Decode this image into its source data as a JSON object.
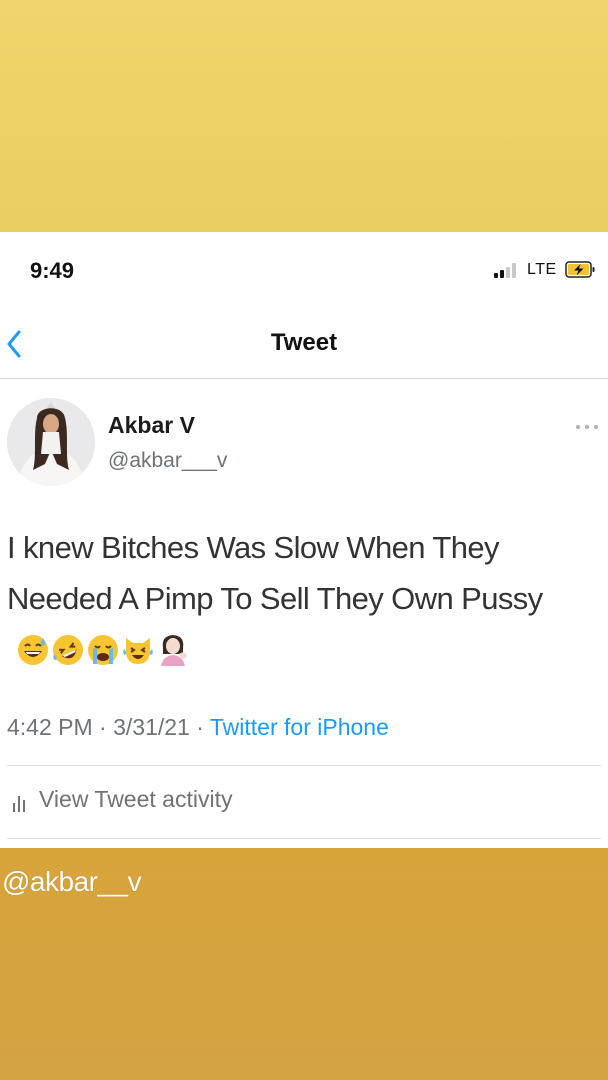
{
  "colors": {
    "accent_blue": "#1d9bf0",
    "background_top": "#edd063",
    "background_bottom": "#d6a43e",
    "text_secondary": "#6e7378"
  },
  "status_bar": {
    "time": "9:49",
    "network": "LTE",
    "icons": [
      "signal-icon",
      "battery-charging-icon"
    ]
  },
  "nav": {
    "back_icon": "chevron-left-icon",
    "title": "Tweet"
  },
  "tweet": {
    "display_name": "Akbar V",
    "handle": "@akbar___v",
    "text": "I knew Bitches Was Slow When They Needed A Pimp To Sell They Own Pussy",
    "emojis": [
      "sweat-smile-emoji",
      "rofl-emoji",
      "crying-emoji",
      "crying-cat-emoji",
      "woman-tipping-hand-emoji"
    ],
    "time": "4:42 PM",
    "separator": "·",
    "date": "3/31/21",
    "source": "Twitter for iPhone",
    "activity_label": "View Tweet activity",
    "more_icon": "more-options-icon"
  },
  "caption": "@akbar__v"
}
